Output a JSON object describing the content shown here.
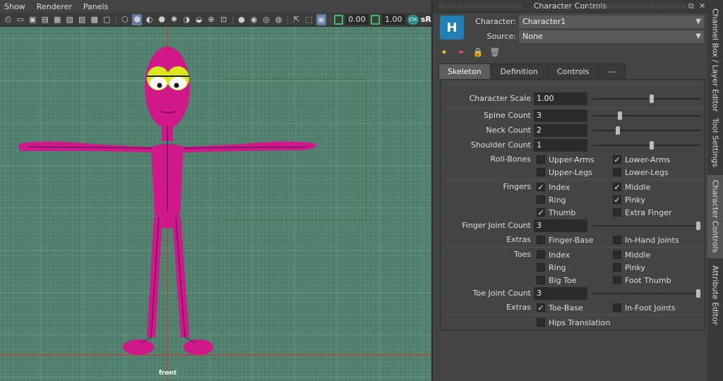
{
  "viewport": {
    "menu": [
      "Show",
      "Renderer",
      "Panels"
    ],
    "field1": "0.00",
    "field2": "1.00",
    "cm_label": "CM",
    "srgb_label": "sR",
    "camera_label": "front"
  },
  "panel": {
    "title": "Character Controls",
    "character_label": "Character:",
    "character_value": "Character1",
    "source_label": "Source:",
    "source_value": "None",
    "logo_glyph": "H",
    "icons": [
      "spark-icon",
      "filter-icon",
      "lock-icon",
      "trash-icon"
    ],
    "tabs": [
      "Skeleton",
      "Definition",
      "Controls",
      "---"
    ],
    "active_tab": "Skeleton",
    "character_scale": {
      "label": "Character Scale",
      "value": "1.00",
      "level": 0.55
    },
    "spine_count": {
      "label": "Spine Count",
      "value": "3",
      "level": 0.24
    },
    "neck_count": {
      "label": "Neck Count",
      "value": "2",
      "level": 0.22
    },
    "shoulder_count": {
      "label": "Shoulder Count",
      "value": "1",
      "level": 0.55
    },
    "roll_bones": {
      "label": "Roll-Bones",
      "upper_arms": {
        "label": "Upper-Arms",
        "checked": false
      },
      "lower_arms": {
        "label": "Lower-Arms",
        "checked": true
      },
      "upper_legs": {
        "label": "Upper-Legs",
        "checked": false
      },
      "lower_legs": {
        "label": "Lower-Legs",
        "checked": false
      }
    },
    "fingers": {
      "label": "Fingers",
      "index": {
        "label": "Index",
        "checked": true
      },
      "middle": {
        "label": "Middle",
        "checked": true
      },
      "ring": {
        "label": "Ring",
        "checked": false
      },
      "pinky": {
        "label": "Pinky",
        "checked": true
      },
      "thumb": {
        "label": "Thumb",
        "checked": true
      },
      "extra_finger": {
        "label": "Extra Finger",
        "checked": false
      }
    },
    "finger_joint_count": {
      "label": "Finger Joint Count",
      "value": "3",
      "level": 1.0
    },
    "finger_extras": {
      "label": "Extras",
      "finger_base": {
        "label": "Finger-Base",
        "checked": false
      },
      "in_hand_joints": {
        "label": "In-Hand Joints",
        "checked": false
      }
    },
    "toes": {
      "label": "Toes",
      "index": {
        "label": "Index",
        "checked": false
      },
      "middle": {
        "label": "Middle",
        "checked": false
      },
      "ring": {
        "label": "Ring",
        "checked": false
      },
      "pinky": {
        "label": "Pinky",
        "checked": false
      },
      "big_toe": {
        "label": "Big Toe",
        "checked": false
      },
      "foot_thumb": {
        "label": "Foot Thumb",
        "checked": false
      }
    },
    "toe_joint_count": {
      "label": "Toe Joint Count",
      "value": "3",
      "level": 1.0
    },
    "toe_extras": {
      "label": "Extras",
      "toe_base": {
        "label": "Toe-Base",
        "checked": true
      },
      "in_foot_joints": {
        "label": "In-Foot Joints",
        "checked": false
      }
    },
    "hips_translation": {
      "label": "Hips Translation",
      "checked": false
    }
  },
  "side_tabs": [
    "Channel Box / Layer Editor",
    "Tool Settings",
    "Character Controls",
    "Attribute Editor"
  ],
  "colors": {
    "character": "#d0188a",
    "eyes": "#d8e818",
    "grid_bg": "#4f7f6b",
    "axis": "#c23b3b",
    "accent": "#5b7fa6"
  }
}
